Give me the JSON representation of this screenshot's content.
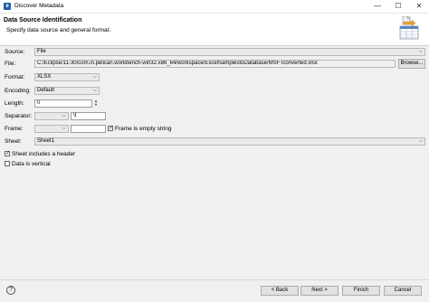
{
  "window": {
    "title": "Discover Metadata",
    "minimize": "—",
    "maximize": "☐",
    "close": "✕"
  },
  "header": {
    "title": "Data Source Identification",
    "description": "Specify data source and general format."
  },
  "form": {
    "source": {
      "label": "Source:",
      "value": "File"
    },
    "file": {
      "label": "File:",
      "value": "C:/Eclipse/11-30/com.in.pelican.workbench-win32.x86_64/workspace/ExcelSamplestoDatabase/MSFTconverted.xlsx",
      "browse": "Browse..."
    },
    "format": {
      "label": "Format:",
      "value": "XLSX"
    },
    "encoding": {
      "label": "Encoding:",
      "value": "Default"
    },
    "length": {
      "label": "Length:",
      "value": "0"
    },
    "separator": {
      "label": "Separator:",
      "value": "",
      "text": "\\t"
    },
    "frame": {
      "label": "Frame:",
      "value": "",
      "text": "",
      "empty_label": "Frame is empty string",
      "empty_checked": true
    },
    "sheet": {
      "label": "Sheet:",
      "value": "Sheet1"
    },
    "includes_header": {
      "label": "Sheet includes a header",
      "checked": true
    },
    "is_vertical": {
      "label": "Data is vertical",
      "checked": false
    }
  },
  "footer": {
    "help": "?",
    "back": "< Back",
    "next": "Next >",
    "finish": "Finish",
    "cancel": "Cancel"
  }
}
